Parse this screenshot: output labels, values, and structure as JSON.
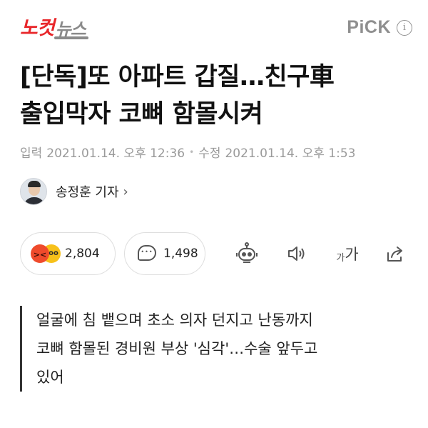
{
  "header": {
    "logo_red": "노컷",
    "logo_gray": "뉴스",
    "pick_label": "PiCK",
    "info_glyph": "i"
  },
  "article": {
    "headline_line1": "[단독]또 아파트 갑질…친구車",
    "headline_line2": "출입막자 코뼈 함몰시켜",
    "input_label": "입력",
    "input_date": "2021.01.14. 오후 12:36",
    "edit_label": "수정",
    "edit_date": "2021.01.14. 오후 1:53",
    "separator": "•",
    "reporter": "송정훈 기자",
    "reporter_chevron": "›",
    "subtitle_line1": "얼굴에 침 뱉으며 초소 의자 던지고 난동까지",
    "subtitle_line2": "코뼈 함몰된 경비원 부상 '심각'…수술 앞두고",
    "subtitle_line3": "있어"
  },
  "actions": {
    "reaction_count": "2,804",
    "comment_count": "1,498",
    "font_small": "가",
    "font_big": "가",
    "icons": [
      "angry-face-icon",
      "glasses-face-icon",
      "comment-bubble-icon",
      "robot-icon",
      "speaker-icon",
      "font-size-icon",
      "share-icon"
    ]
  },
  "colors": {
    "brand_red": "#e8262a",
    "muted_gray": "#9a9a9a"
  }
}
